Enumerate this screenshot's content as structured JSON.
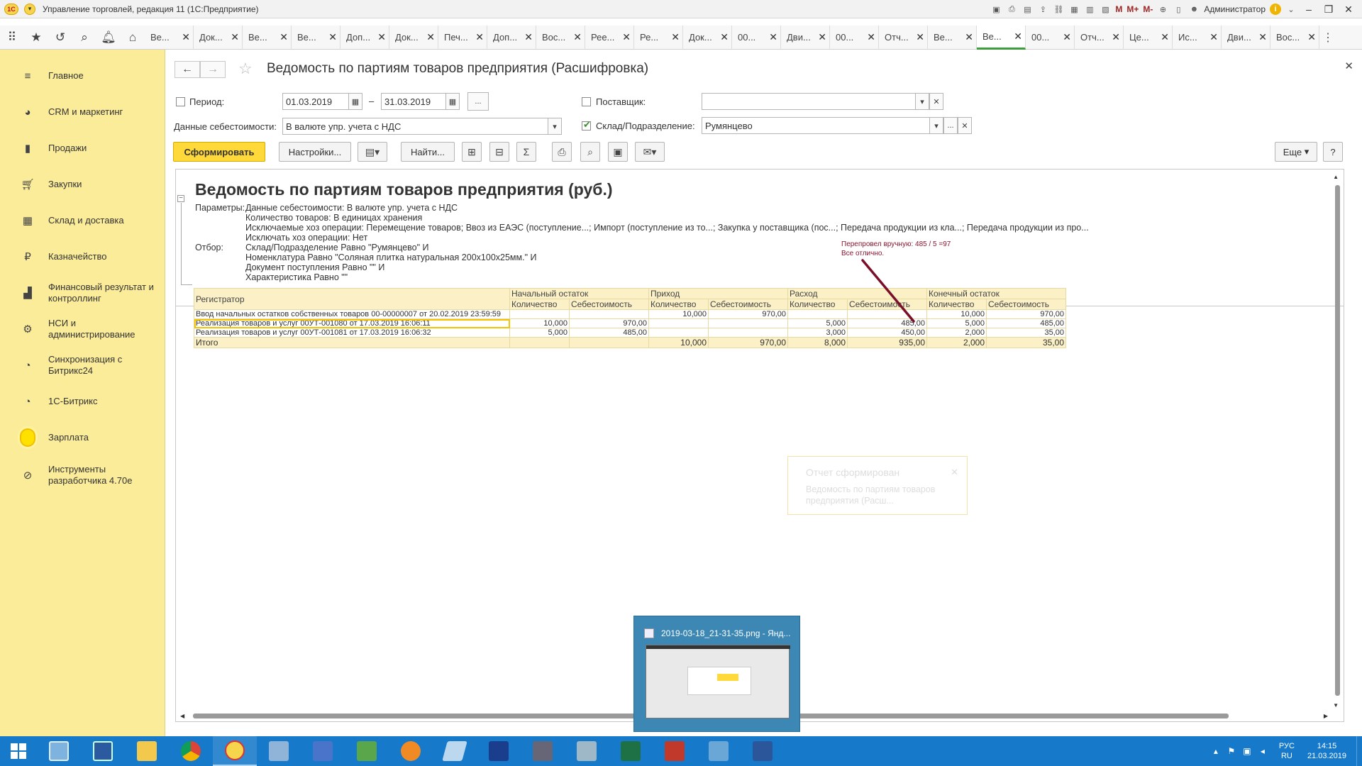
{
  "window": {
    "title": "Управление торговлей, редакция 11  (1С:Предприятие)",
    "user": "Администратор",
    "toolbar_buttons": [
      "M",
      "M+",
      "M-"
    ]
  },
  "tabs": [
    {
      "label": "Ве..."
    },
    {
      "label": "Док..."
    },
    {
      "label": "Ве..."
    },
    {
      "label": "Ве..."
    },
    {
      "label": "Доп..."
    },
    {
      "label": "Док..."
    },
    {
      "label": "Печ..."
    },
    {
      "label": "Доп..."
    },
    {
      "label": "Вос..."
    },
    {
      "label": "Рее..."
    },
    {
      "label": "Ре..."
    },
    {
      "label": "Док..."
    },
    {
      "label": "00..."
    },
    {
      "label": "Дви..."
    },
    {
      "label": "00..."
    },
    {
      "label": "Отч..."
    },
    {
      "label": "Ве..."
    },
    {
      "label": "Ве...",
      "active": true
    },
    {
      "label": "00..."
    },
    {
      "label": "Отч..."
    },
    {
      "label": "Це..."
    },
    {
      "label": "Ис..."
    },
    {
      "label": "Дви..."
    },
    {
      "label": "Вос..."
    }
  ],
  "sidebar": {
    "items": [
      {
        "label": "Главное",
        "icon": "menu-icon"
      },
      {
        "label": "CRM и маркетинг",
        "icon": "crm-icon"
      },
      {
        "label": "Продажи",
        "icon": "bag-icon"
      },
      {
        "label": "Закупки",
        "icon": "cart-icon"
      },
      {
        "label": "Склад и доставка",
        "icon": "warehouse-icon"
      },
      {
        "label": "Казначейство",
        "icon": "ruble-icon"
      },
      {
        "label": "Финансовый результат и контроллинг",
        "icon": "chart-icon"
      },
      {
        "label": "НСИ и администрирование",
        "icon": "gear-icon"
      },
      {
        "label": "Синхронизация с Битрикс24",
        "icon": "sync-icon"
      },
      {
        "label": "1С-Битрикс",
        "icon": "sync-icon"
      },
      {
        "label": "Зарплата",
        "icon": "sun-icon"
      },
      {
        "label": "Инструменты разработчика 4.70е",
        "icon": "tools-icon"
      }
    ]
  },
  "form": {
    "title": "Ведомость по партиям товаров предприятия (Расшифровка)",
    "period_label": "Период:",
    "period_from": "01.03.2019",
    "period_dash": "–",
    "period_to": "31.03.2019",
    "cost_data_label": "Данные себестоимости:",
    "cost_data_value": "В валюте упр. учета с НДС",
    "supplier_label": "Поставщик:",
    "supplier_value": "",
    "warehouse_label": "Склад/Подразделение:",
    "warehouse_value": "Румянцево",
    "warehouse_checked": true,
    "period_checked": false,
    "supplier_checked": false,
    "buttons": {
      "generate": "Сформировать",
      "settings": "Настройки...",
      "find": "Найти...",
      "more": "Еще",
      "help": "?",
      "dots": "..."
    }
  },
  "report": {
    "title": "Ведомость по партиям товаров предприятия (руб.)",
    "params_label": "Параметры:",
    "params": [
      "Данные себестоимости: В валюте упр. учета с НДС",
      "Количество товаров: В единицах хранения",
      "Исключаемые хоз операции: Перемещение товаров; Ввоз из ЕАЭС (поступление...; Импорт (поступление из то...; Закупка у поставщика (пос...; Передача продукции из кла...; Передача продукции из про...",
      "Исключать хоз операции: Нет"
    ],
    "filter_label": "Отбор:",
    "filters": [
      "Склад/Подразделение Равно \"Румянцево\" И",
      "Номенклатура Равно \"Соляная плитка натуральная 200x100x25мм.\" И",
      "Документ поступления Равно \"\" И",
      "Характеристика Равно \"\""
    ],
    "annotation": [
      "Перепровел вручную: 485 / 5 =97",
      "Все отлично."
    ],
    "columns": {
      "registrar": "Регистратор",
      "groups": [
        "Начальный остаток",
        "Приход",
        "Расход",
        "Конечный остаток"
      ],
      "qty": "Количество",
      "cost": "Себестоимость"
    },
    "rows": [
      {
        "registrar": "Ввод начальных остатков собственных товаров 00-00000007 от 20.02.2019 23:59:59",
        "v": [
          "",
          "",
          "10,000",
          "970,00",
          "",
          "",
          "10,000",
          "970,00"
        ]
      },
      {
        "registrar": "Реализация товаров и услуг 00УТ-001080 от 17.03.2019 16:06:11",
        "v": [
          "10,000",
          "970,00",
          "",
          "",
          "5,000",
          "485,00",
          "5,000",
          "485,00"
        ],
        "selected": true
      },
      {
        "registrar": "Реализация товаров и услуг 00УТ-001081 от 17.03.2019 16:06:32",
        "v": [
          "5,000",
          "485,00",
          "",
          "",
          "3,000",
          "450,00",
          "2,000",
          "35,00"
        ]
      }
    ],
    "total": {
      "label": "Итого",
      "v": [
        "",
        "",
        "10,000",
        "970,00",
        "8,000",
        "935,00",
        "2,000",
        "35,00"
      ]
    }
  },
  "toast": {
    "title": "Отчет сформирован",
    "body": "Ведомость по партиям товаров предприятия (Расш..."
  },
  "taskbar_thumbnail": {
    "title": "2019-03-18_21-31-35.png - Янд..."
  },
  "tray": {
    "lang_top": "РУС",
    "lang_bottom": "RU",
    "time": "14:15",
    "date": "21.03.2019"
  },
  "colors": {
    "accent_yellow": "#ffd83a",
    "sidebar_bg": "#fbec9a",
    "taskbar": "#1679c9",
    "annotation": "#8a1530"
  }
}
